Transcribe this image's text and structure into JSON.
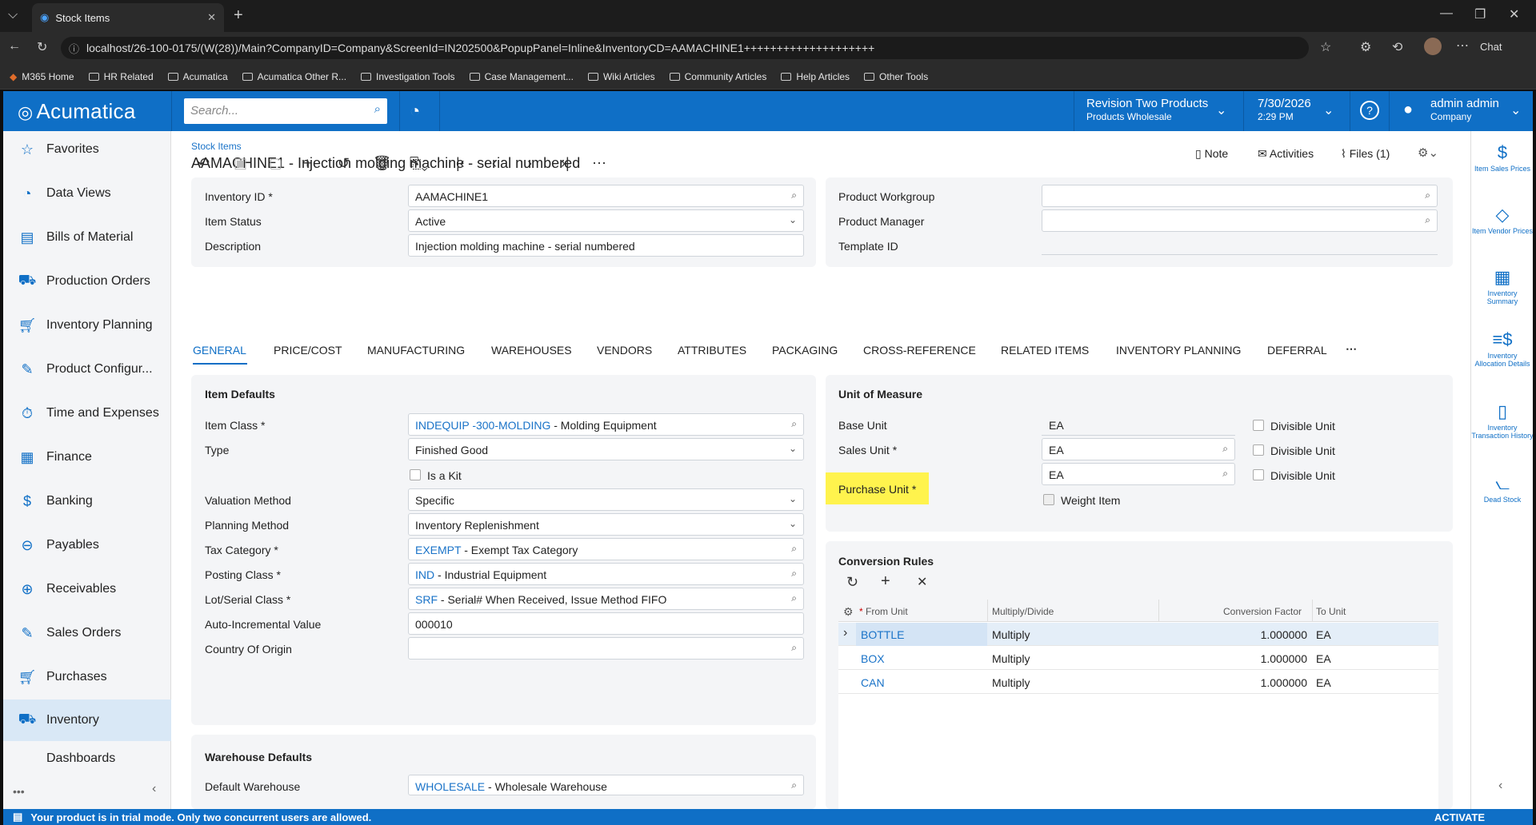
{
  "browser": {
    "tab_title": "Stock Items",
    "url": "localhost/26-100-0175/(W(28))/Main?CompanyID=Company&ScreenId=IN202500&PopupPanel=Inline&InventoryCD=AAMACHINE1++++++++++++++++++++",
    "chat_label": "Chat",
    "bookmarks": [
      "M365 Home",
      "HR Related",
      "Acumatica",
      "Acumatica Other R...",
      "Investigation Tools",
      "Case Management...",
      "Wiki Articles",
      "Community Articles",
      "Help Articles",
      "Other Tools"
    ]
  },
  "topnav": {
    "logo": "Acumatica",
    "search_placeholder": "Search...",
    "branch_line1": "Revision Two Products",
    "branch_line2": "Products Wholesale",
    "date": "7/30/2026",
    "time": "2:29 PM",
    "user": "admin admin",
    "company": "Company"
  },
  "sidebar": {
    "items": [
      "Favorites",
      "Data Views",
      "Bills of Material",
      "Production Orders",
      "Inventory Planning",
      "Product Configur...",
      "Time and Expenses",
      "Finance",
      "Banking",
      "Payables",
      "Receivables",
      "Sales Orders",
      "Purchases",
      "Inventory",
      "Dashboards"
    ]
  },
  "page": {
    "breadcrumb": "Stock Items",
    "title": "AAMACHINE1 - Injection molding machine - serial numbered",
    "note": "Note",
    "activities": "Activities",
    "files": "Files (1)"
  },
  "header_form": {
    "inventory_id_label": "Inventory ID",
    "inventory_id": "AAMACHINE1",
    "item_status_label": "Item Status",
    "item_status": "Active",
    "description_label": "Description",
    "description": "Injection molding machine - serial numbered",
    "product_workgroup_label": "Product Workgroup",
    "product_manager_label": "Product Manager",
    "template_id_label": "Template ID"
  },
  "tabs": [
    "GENERAL",
    "PRICE/COST",
    "MANUFACTURING",
    "WAREHOUSES",
    "VENDORS",
    "ATTRIBUTES",
    "PACKAGING",
    "CROSS-REFERENCE",
    "RELATED ITEMS",
    "INVENTORY PLANNING",
    "DEFERRAL"
  ],
  "item_defaults": {
    "heading": "Item Defaults",
    "item_class_label": "Item Class",
    "item_class_code": "INDEQUIP -300-MOLDING",
    "item_class_desc": " - Molding Equipment",
    "type_label": "Type",
    "type": "Finished Good",
    "is_kit": "Is a Kit",
    "valuation_label": "Valuation Method",
    "valuation": "Specific",
    "planning_label": "Planning Method",
    "planning": "Inventory Replenishment",
    "tax_label": "Tax Category",
    "tax_code": "EXEMPT",
    "tax_desc": " - Exempt Tax Category",
    "posting_label": "Posting Class",
    "posting_code": "IND",
    "posting_desc": " - Industrial Equipment",
    "lot_label": "Lot/Serial Class",
    "lot_code": "SRF",
    "lot_desc": " - Serial# When Received, Issue Method FIFO",
    "auto_label": "Auto-Incremental Value",
    "auto": "000010",
    "country_label": "Country Of Origin"
  },
  "warehouse_defaults": {
    "heading": "Warehouse Defaults",
    "default_wh_label": "Default Warehouse",
    "default_wh_code": "WHOLESALE",
    "default_wh_desc": " - Wholesale Warehouse"
  },
  "uom": {
    "heading": "Unit of Measure",
    "base_label": "Base Unit",
    "base": "EA",
    "sales_label": "Sales Unit",
    "sales": "EA",
    "purchase_label": "Purchase Unit",
    "purchase": "EA",
    "divisible": "Divisible Unit",
    "weight_item": "Weight Item"
  },
  "conversion": {
    "heading": "Conversion Rules",
    "columns": [
      "From Unit",
      "Multiply/Divide",
      "Conversion Factor",
      "To Unit"
    ],
    "rows": [
      {
        "from": "BOTTLE",
        "op": "Multiply",
        "factor": "1.000000",
        "to": "EA"
      },
      {
        "from": "BOX",
        "op": "Multiply",
        "factor": "1.000000",
        "to": "EA"
      },
      {
        "from": "CAN",
        "op": "Multiply",
        "factor": "1.000000",
        "to": "EA"
      }
    ]
  },
  "right_panel": [
    "Item Sales Prices",
    "Item Vendor Prices",
    "Inventory Summary",
    "Inventory Allocation Details",
    "Inventory Transaction History",
    "Dead Stock"
  ],
  "footer": {
    "message": "Your product is in trial mode. Only two concurrent users are allowed.",
    "activate": "ACTIVATE"
  },
  "colors": {
    "brand": "#0f6fc6",
    "highlight": "#fff34d",
    "link": "#1a73c8"
  }
}
